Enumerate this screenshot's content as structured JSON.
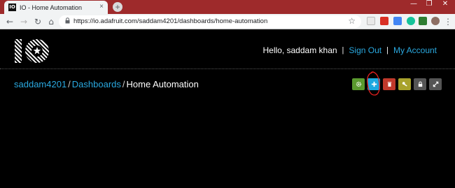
{
  "browser": {
    "tab_title": "IO - Home Automation",
    "tab_close": "×",
    "new_tab": "+",
    "url": "https://io.adafruit.com/saddam4201/dashboards/home-automation",
    "favicon_text": "IO",
    "window_controls": {
      "minimize": "—",
      "maximize": "❐",
      "close": "✕"
    },
    "nav": {
      "back": "←",
      "forward": "→",
      "reload": "↻",
      "home": "⌂",
      "bookmark": "☆"
    }
  },
  "header": {
    "greeting": "Hello, saddam khan",
    "separator": "|",
    "sign_out": "Sign Out",
    "my_account": "My Account"
  },
  "breadcrumb": {
    "user": "saddam4201",
    "dashboards": "Dashboards",
    "current": "Home Automation",
    "separator": "/"
  },
  "actions": [
    {
      "name": "settings",
      "color": "#5a9a2e",
      "icon": "gear-icon"
    },
    {
      "name": "add-block",
      "color": "#1ca8e0",
      "icon": "plus-icon"
    },
    {
      "name": "delete",
      "color": "#c0392b",
      "icon": "trash-icon"
    },
    {
      "name": "share-key",
      "color": "#a8a22c",
      "icon": "key-icon"
    },
    {
      "name": "lock",
      "color": "#555555",
      "icon": "lock-icon"
    },
    {
      "name": "fullscreen",
      "color": "#555555",
      "icon": "expand-icon"
    }
  ],
  "colors": {
    "link": "#2aa9e0",
    "background": "#000000",
    "annotation": "#e0201f"
  }
}
